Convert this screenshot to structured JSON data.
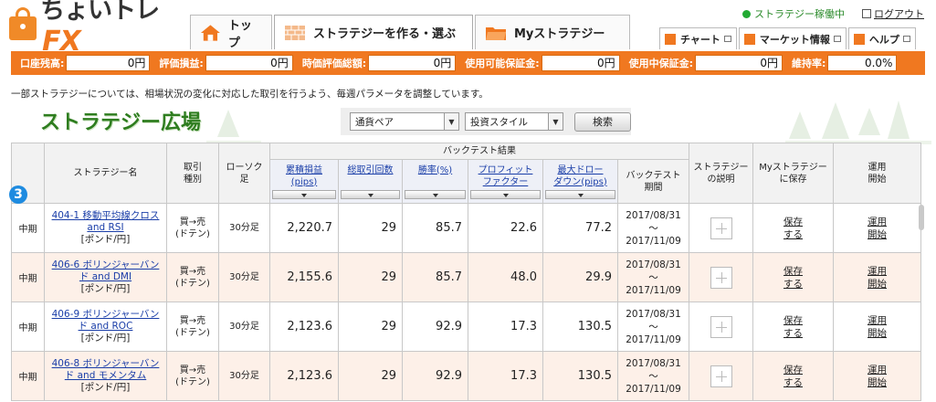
{
  "header": {
    "logo_text": "ちょいトレ",
    "logo_fx": "FX",
    "status_text": "ストラテジー稼働中",
    "logout_label": "ログアウト",
    "main_tabs": [
      {
        "label": "トップ"
      },
      {
        "label": "ストラテジーを作る・選ぶ"
      },
      {
        "label": "Myストラテジー"
      }
    ],
    "sub_tabs": [
      {
        "label": "チャート"
      },
      {
        "label": "マーケット情報"
      },
      {
        "label": "ヘルプ"
      }
    ]
  },
  "account": [
    {
      "label": "口座残高:",
      "value": "0円"
    },
    {
      "label": "評価損益:",
      "value": "0円"
    },
    {
      "label": "時価評価総額:",
      "value": "0円"
    },
    {
      "label": "使用可能保証金:",
      "value": "0円"
    },
    {
      "label": "使用中保証金:",
      "value": "0円"
    },
    {
      "label": "維持率:",
      "value": "0.0%"
    }
  ],
  "notice": "一部ストラテジーについては、相場状況の変化に対応した取引を行うよう、毎週パラメータを調整しています。",
  "section_title": "ストラテジー広場",
  "filters": {
    "pair_label": "通貨ペア",
    "style_label": "投資スタイル",
    "search_label": "検索"
  },
  "badge": "3",
  "table": {
    "headers": {
      "name": "ストラテジー名",
      "trade_type": "取引\n種別",
      "candle": "ローソク\n足",
      "backtest_group": "バックテスト結果",
      "cum_pips": "累積損益\n(pips)",
      "total_trades": "総取引回数",
      "win_rate": "勝率(%)",
      "profit_factor": "プロフィット\nファクター",
      "max_drawdown": "最大ドロー\nダウン(pips)",
      "period": "バックテスト\n期間",
      "description": "ストラテジー\nの説明",
      "save": "Myストラテジー\nに保存",
      "operate": "運用\n開始"
    },
    "rows": [
      {
        "term": "中期",
        "name": "404-1 移動平均線クロスand RSI",
        "pair": "[ポンド/円]",
        "trade_type": "買→売\n(ドテン)",
        "candle": "30分足",
        "cum_pips": "2,220.7",
        "total_trades": "29",
        "win_rate": "85.7",
        "profit_factor": "22.6",
        "max_drawdown": "77.2",
        "period_start": "2017/08/31",
        "period_sep": "〜",
        "period_end": "2017/11/09",
        "save": "保存\nする",
        "operate": "運用\n開始"
      },
      {
        "term": "中期",
        "name": "406-6 ボリンジャーバンド and DMI",
        "pair": "[ポンド/円]",
        "trade_type": "買→売\n(ドテン)",
        "candle": "30分足",
        "cum_pips": "2,155.6",
        "total_trades": "29",
        "win_rate": "85.7",
        "profit_factor": "48.0",
        "max_drawdown": "29.9",
        "period_start": "2017/08/31",
        "period_sep": "〜",
        "period_end": "2017/11/09",
        "save": "保存\nする",
        "operate": "運用\n開始"
      },
      {
        "term": "中期",
        "name": "406-9 ボリンジャーバンド and ROC",
        "pair": "[ポンド/円]",
        "trade_type": "買→売\n(ドテン)",
        "candle": "30分足",
        "cum_pips": "2,123.6",
        "total_trades": "29",
        "win_rate": "92.9",
        "profit_factor": "17.3",
        "max_drawdown": "130.5",
        "period_start": "2017/08/31",
        "period_sep": "〜",
        "period_end": "2017/11/09",
        "save": "保存\nする",
        "operate": "運用\n開始"
      },
      {
        "term": "中期",
        "name": "406-8 ボリンジャーバンド and モメンタム",
        "pair": "[ポンド/円]",
        "trade_type": "買→売\n(ドテン)",
        "candle": "30分足",
        "cum_pips": "2,123.6",
        "total_trades": "29",
        "win_rate": "92.9",
        "profit_factor": "17.3",
        "max_drawdown": "130.5",
        "period_start": "2017/08/31",
        "period_sep": "〜",
        "period_end": "2017/11/09",
        "save": "保存\nする",
        "operate": "運用\n開始"
      }
    ]
  },
  "colors": {
    "brand_orange": "#f07820",
    "title_green": "#2e7d1f",
    "link_blue": "#1a3ea8",
    "row_alt": "#fdf0e8",
    "status_green": "#22aa33",
    "badge_blue": "#1e8be0"
  }
}
